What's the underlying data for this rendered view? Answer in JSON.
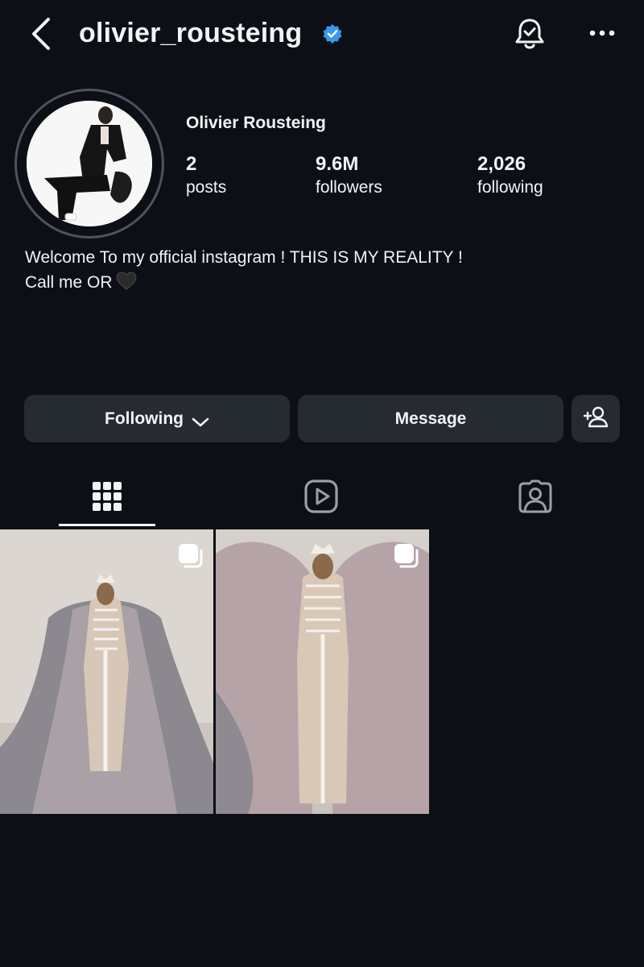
{
  "header": {
    "username": "olivier_rousteing",
    "icons": [
      "back-arrow-icon",
      "verified-badge-icon",
      "notification-bell-icon",
      "more-options-icon"
    ]
  },
  "profile": {
    "full_name": "Olivier Rousteing",
    "stats": [
      {
        "value": "2",
        "label": "posts"
      },
      {
        "value": "9.6M",
        "label": "followers"
      },
      {
        "value": "2,026",
        "label": "following"
      }
    ],
    "bio_line1": "Welcome To my official instagram ! THIS IS MY REALITY !",
    "bio_line2": "Call me OR"
  },
  "actions": {
    "following_label": "Following",
    "message_label": "Message"
  },
  "tabs": [
    "grid-icon",
    "reels-icon",
    "tagged-icon"
  ],
  "colors": {
    "background": "#0c1016",
    "button": "#262a31",
    "verified": "#3897f0",
    "text": "#f2f3f5"
  }
}
